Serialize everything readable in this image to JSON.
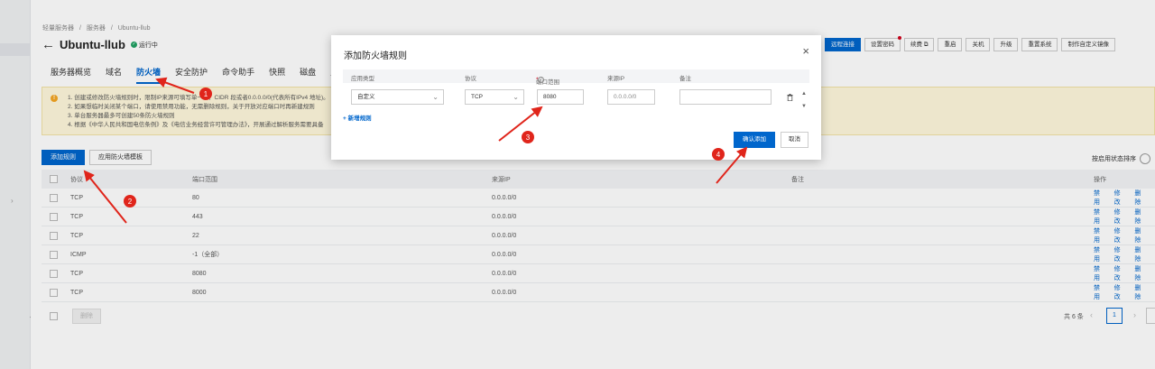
{
  "breadcrumb": [
    "轻量服务器",
    "/",
    "服务器",
    "/",
    "Ubuntu-llub"
  ],
  "server": {
    "name": "Ubuntu-llub",
    "status": "运行中"
  },
  "tabs": [
    "服务器概览",
    "域名",
    "防火墙",
    "安全防护",
    "命令助手",
    "快照",
    "磁盘",
    "监控"
  ],
  "actions": [
    "远程连接",
    "设置密码",
    "续费",
    "重启",
    "关机",
    "升级",
    "重置系统",
    "制作自定义镜像"
  ],
  "notice": {
    "lines": [
      "1. 创建或修改防火墙规则时，限制IP来源可填写单一IP、CIDR 段或者0.0.0.0/0(代表所有IPv4 地址)。",
      "2. 如果想临时关闭某个端口，请使用禁用功能，无需删除规则，关于开放对应端口时再新建规则",
      "3. 单台服务器最多可创建50条防火墙规则",
      "4. 根据《中华人民共和国电信条例》及《电信业务经营许可管理办法》，开展通过解析服务需要具备"
    ]
  },
  "toolbar": {
    "add_rule": "添加规则",
    "apply_template": "应用防火墙模板",
    "sort_label": "按启用状态排序"
  },
  "table": {
    "headers": [
      "协议",
      "端口范围",
      "来源IP",
      "备注",
      "操作"
    ],
    "rows": [
      {
        "protocol": "TCP",
        "port": "80",
        "source": "0.0.0.0/0",
        "note": ""
      },
      {
        "protocol": "TCP",
        "port": "443",
        "source": "0.0.0.0/0",
        "note": ""
      },
      {
        "protocol": "TCP",
        "port": "22",
        "source": "0.0.0.0/0",
        "note": ""
      },
      {
        "protocol": "ICMP",
        "port": "-1（全部）",
        "source": "0.0.0.0/0",
        "note": ""
      },
      {
        "protocol": "TCP",
        "port": "8080",
        "source": "0.0.0.0/0",
        "note": ""
      },
      {
        "protocol": "TCP",
        "port": "8000",
        "source": "0.0.0.0/0",
        "note": ""
      }
    ],
    "row_ops": [
      "禁用",
      "修改",
      "删除"
    ],
    "bulk_delete": "删除",
    "total": "共 6 条",
    "page": "1"
  },
  "dialog": {
    "title": "添加防火墙规则",
    "headers": [
      "应用类型",
      "协议",
      "端口范围",
      "来源IP",
      "备注"
    ],
    "required_mark": "*",
    "app_type": "自定义",
    "protocol": "TCP",
    "port": "8080",
    "source_placeholder": "0.0.0.0/0",
    "note": "",
    "add_row": "+ 新增规则",
    "confirm": "确认添加",
    "cancel": "取消"
  },
  "annotations": [
    "1",
    "2",
    "3",
    "4"
  ],
  "colors": {
    "primary": "#0066cc",
    "annotation": "#e0251b",
    "notice_bg": "#fff8dc",
    "status": "#20a162"
  }
}
